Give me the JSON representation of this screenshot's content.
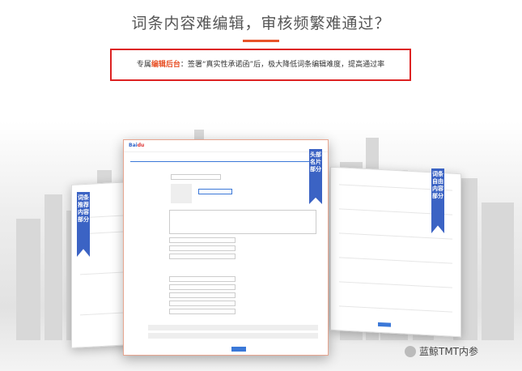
{
  "header": {
    "title": "词条内容难编辑，审核频繁难通过？"
  },
  "banner": {
    "prefix": "专属",
    "highlight": "编辑后台",
    "suffix": "：签署“真实性承诺函”后，极大降低词条编辑难度，提高通过率"
  },
  "ribbons": {
    "left": "词条推荐内容部分",
    "center": "头部名片部分",
    "right": "词条自由内容部分"
  },
  "watermark": {
    "text": "蓝鲸TMT内参"
  },
  "colors": {
    "accent": "#e8542a",
    "frame_red": "#dd2222",
    "ribbon_blue": "#3b63c4"
  }
}
